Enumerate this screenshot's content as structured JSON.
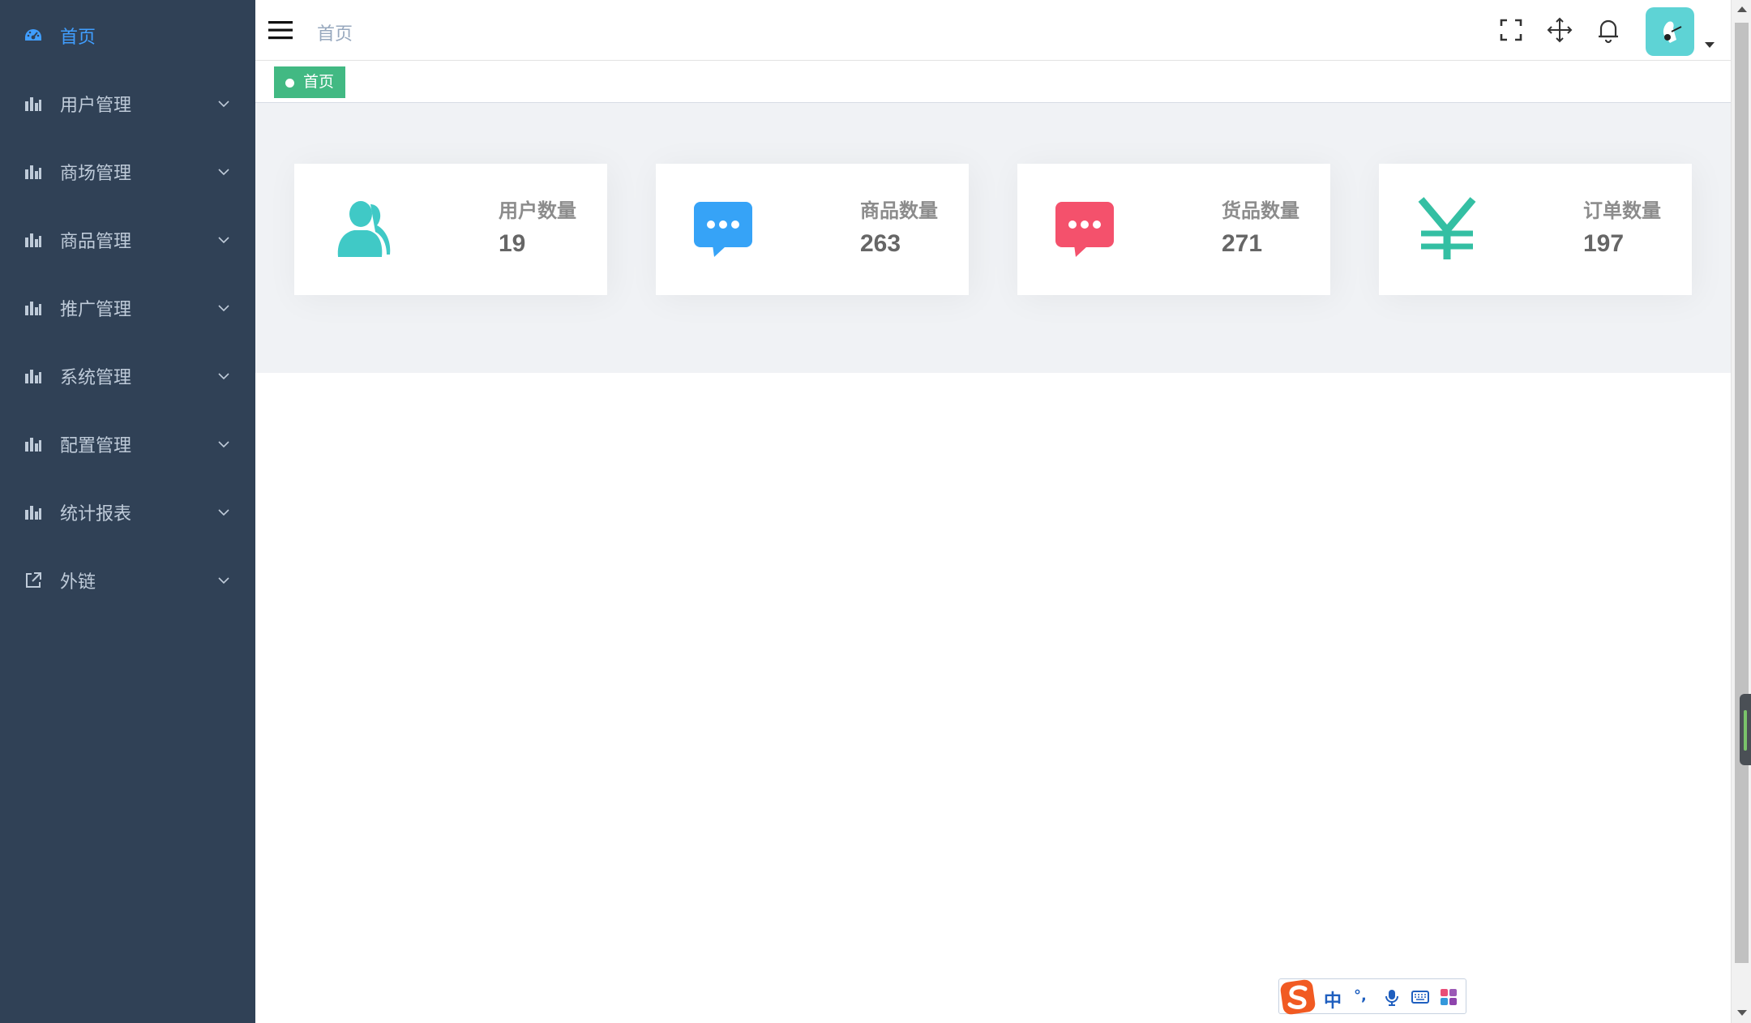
{
  "sidebar": {
    "items": [
      {
        "label": "首页",
        "icon": "dashboard-icon",
        "active": true
      },
      {
        "label": "用户管理",
        "icon": "bar-chart-icon"
      },
      {
        "label": "商场管理",
        "icon": "bar-chart-icon"
      },
      {
        "label": "商品管理",
        "icon": "bar-chart-icon"
      },
      {
        "label": "推广管理",
        "icon": "bar-chart-icon"
      },
      {
        "label": "系统管理",
        "icon": "bar-chart-icon"
      },
      {
        "label": "配置管理",
        "icon": "bar-chart-icon"
      },
      {
        "label": "统计报表",
        "icon": "bar-chart-icon"
      },
      {
        "label": "外链",
        "icon": "external-link-icon"
      }
    ],
    "colors": {
      "background": "#304156",
      "text": "#bfcbd9",
      "active": "#409eff"
    }
  },
  "header": {
    "breadcrumb": "首页",
    "icons": [
      "hamburger-icon",
      "fullscreen-icon",
      "move-icon",
      "bell-icon",
      "avatar",
      "caret-down-icon"
    ]
  },
  "tags": {
    "active_tag": "首页",
    "color": "#42b983"
  },
  "cards": [
    {
      "title": "用户数量",
      "value": "19",
      "icon": "users-icon",
      "color": "#40c9c6"
    },
    {
      "title": "商品数量",
      "value": "263",
      "icon": "message-icon",
      "color": "#36a3f7"
    },
    {
      "title": "货品数量",
      "value": "271",
      "icon": "message-icon",
      "color": "#f4516c"
    },
    {
      "title": "订单数量",
      "value": "197",
      "icon": "yuan-icon",
      "color": "#34bfa3"
    }
  ],
  "ime": {
    "mode": "中",
    "punct": "°,"
  }
}
